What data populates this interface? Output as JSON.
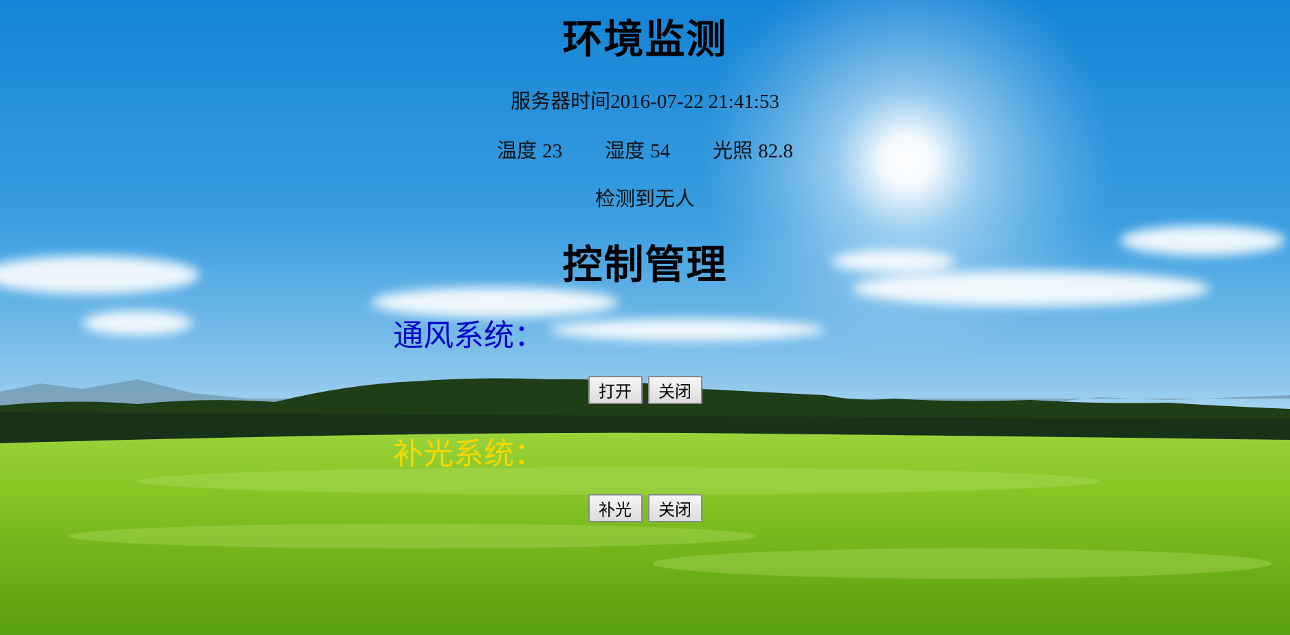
{
  "monitor": {
    "title": "环境监测",
    "server_time_label": "服务器时间",
    "server_time": "2016-07-22 21:41:53",
    "temperature_label": "温度",
    "temperature_value": "23",
    "humidity_label": "湿度",
    "humidity_value": "54",
    "light_label": "光照",
    "light_value": "82.8",
    "presence_status": "检测到无人"
  },
  "control": {
    "title": "控制管理",
    "ventilation": {
      "label": "通风系统：",
      "color": "#0000cc",
      "open_button": "打开",
      "close_button": "关闭"
    },
    "fill_light": {
      "label": "补光系统：",
      "color": "#f5d800",
      "on_button": "补光",
      "close_button": "关闭"
    }
  },
  "colors": {
    "sky_top": "#1a8ad9",
    "sky_horizon": "#cfe8f6",
    "grass": "#7cc21a",
    "trees": "#1f3d17"
  }
}
